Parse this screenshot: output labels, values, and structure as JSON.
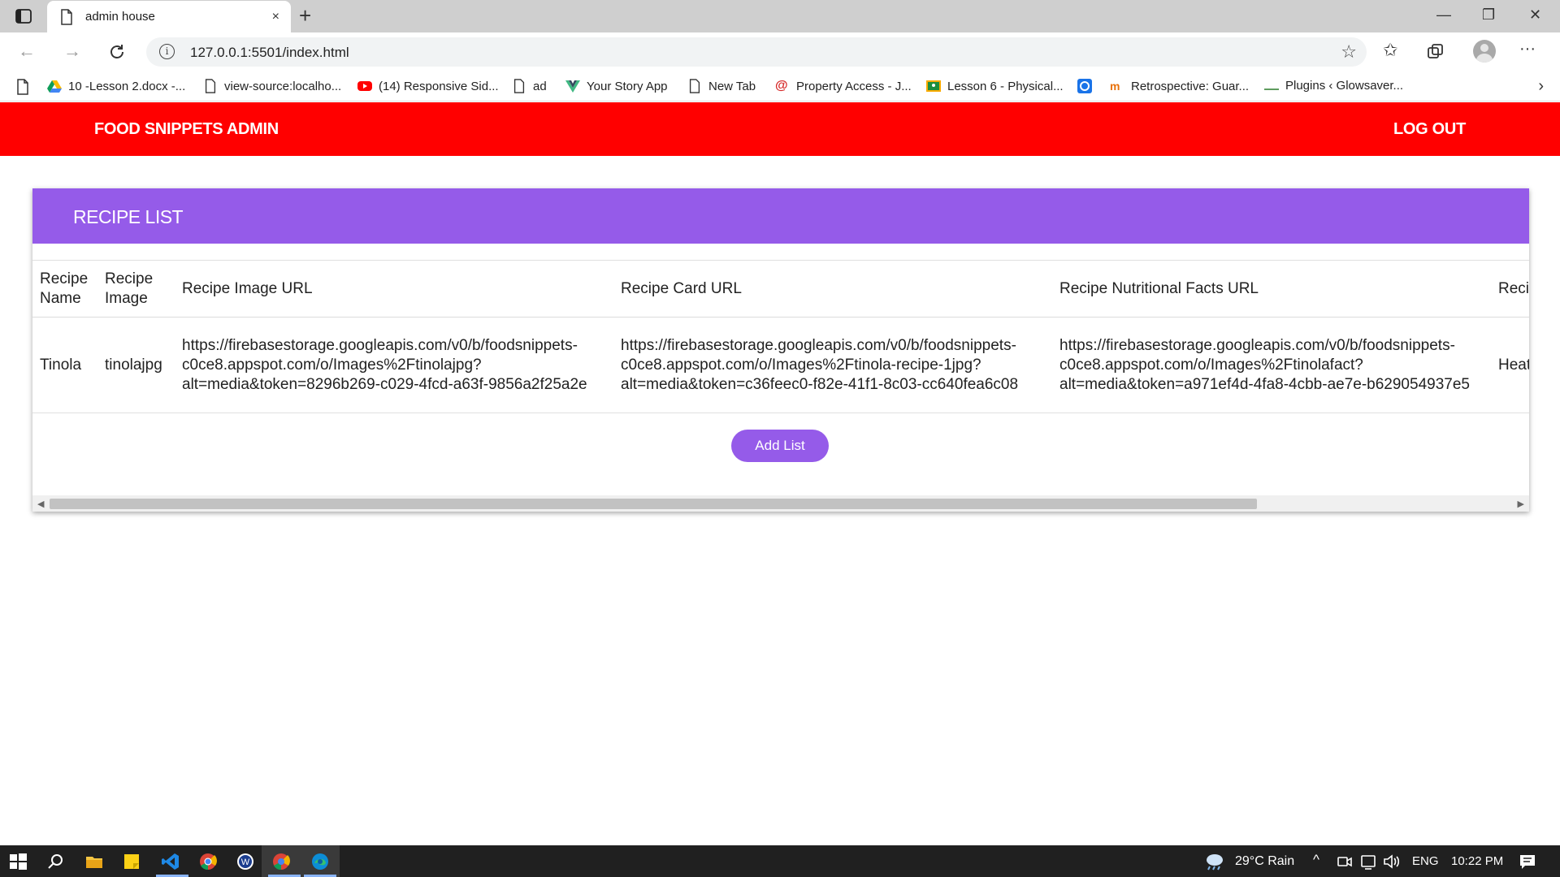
{
  "browser": {
    "tab_title": "admin house",
    "tab_close": "×",
    "new_tab": "+",
    "url": "127.0.0.1:5501/index.html",
    "window_controls": {
      "minimize": "—",
      "restore": "❐",
      "close": "✕"
    },
    "bookmarks": [
      {
        "label": "10 -Lesson 2.docx -...",
        "icon": "google-drive-icon"
      },
      {
        "label": "view-source:localho...",
        "icon": "page-icon"
      },
      {
        "label": "(14) Responsive Sid...",
        "icon": "youtube-icon"
      },
      {
        "label": "ad",
        "icon": "page-icon"
      },
      {
        "label": "Your Story App",
        "icon": "vue-icon"
      },
      {
        "label": "New Tab",
        "icon": "page-icon"
      },
      {
        "label": "Property Access - J...",
        "icon": "at-icon"
      },
      {
        "label": "Lesson 6 - Physical...",
        "icon": "classroom-icon"
      },
      {
        "label": "",
        "icon": "blue-app-icon"
      },
      {
        "label": "Retrospective: Guar...",
        "icon": "tm-icon"
      },
      {
        "label": "Plugins ‹ Glowsaver...",
        "icon": "dash-icon"
      }
    ]
  },
  "app": {
    "brand": "FOOD SNIPPETS ADMIN",
    "logout": "LOG OUT",
    "colors": {
      "appbar": "#ff0000",
      "accent": "#955be9"
    }
  },
  "recipe_list": {
    "title": "RECIPE LIST",
    "columns": [
      "Recipe Name",
      "Recipe Image",
      "Recipe Image URL",
      "Recipe Card URL",
      "Recipe Nutritional Facts URL",
      "Recipe Instructions"
    ],
    "rows": [
      {
        "name": "Tinola",
        "image": "tinolajpg",
        "image_url": "https://firebasestorage.googleapis.com/v0/b/foodsnippets-c0ce8.appspot.com/o/Images%2Ftinolajpg?alt=media&token=8296b269-c029-4fcd-a63f-9856a2f25a2e",
        "card_url": "https://firebasestorage.googleapis.com/v0/b/foodsnippets-c0ce8.appspot.com/o/Images%2Ftinola-recipe-1jpg?alt=media&token=c36feec0-f82e-41f1-8c03-cc640fea6c08",
        "nutrition_url": "https://firebasestorage.googleapis.com/v0/b/foodsnippets-c0ce8.appspot.com/o/Images%2Ftinolafact?alt=media&token=a971ef4d-4fa8-4cbb-ae7e-b629054937e5",
        "instructions": "Heat"
      }
    ],
    "add_button": "Add List"
  },
  "taskbar": {
    "weather": "29°C  Rain",
    "language": "ENG",
    "time": "10:22 PM"
  }
}
